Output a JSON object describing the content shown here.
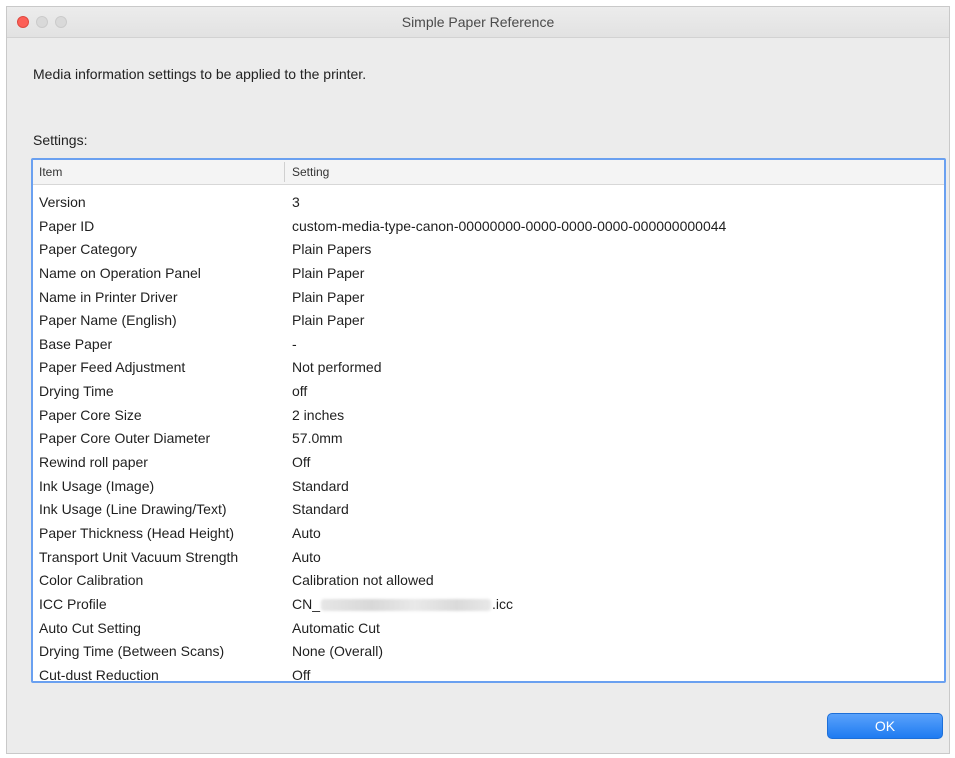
{
  "window": {
    "title": "Simple Paper Reference"
  },
  "description": "Media information settings to be applied to the printer.",
  "settings_label": "Settings:",
  "table": {
    "columns": [
      "Item",
      "Setting"
    ],
    "rows": [
      {
        "item": "Version",
        "setting": "3"
      },
      {
        "item": "Paper ID",
        "setting": "custom-media-type-canon-00000000-0000-0000-0000-000000000044"
      },
      {
        "item": "Paper Category",
        "setting": "Plain Papers"
      },
      {
        "item": "Name on Operation Panel",
        "setting": "Plain Paper"
      },
      {
        "item": "Name in Printer Driver",
        "setting": "Plain Paper"
      },
      {
        "item": "Paper Name (English)",
        "setting": "Plain Paper"
      },
      {
        "item": "Base Paper",
        "setting": "-"
      },
      {
        "item": "Paper Feed Adjustment",
        "setting": "Not performed"
      },
      {
        "item": "Drying Time",
        "setting": "off"
      },
      {
        "item": "Paper Core Size",
        "setting": "2 inches"
      },
      {
        "item": "Paper Core Outer Diameter",
        "setting": "57.0mm"
      },
      {
        "item": "Rewind roll paper",
        "setting": "Off"
      },
      {
        "item": "Ink Usage (Image)",
        "setting": "Standard"
      },
      {
        "item": "Ink Usage (Line Drawing/Text)",
        "setting": "Standard"
      },
      {
        "item": "Paper Thickness (Head Height)",
        "setting": "Auto"
      },
      {
        "item": "Transport Unit Vacuum Strength",
        "setting": "Auto"
      },
      {
        "item": "Color Calibration",
        "setting": "Calibration not allowed"
      },
      {
        "item": "ICC Profile",
        "setting_prefix": "CN_",
        "setting_suffix": ".icc"
      },
      {
        "item": "Auto Cut Setting",
        "setting": "Automatic Cut"
      },
      {
        "item": "Drying Time (Between Scans)",
        "setting": "None (Overall)"
      },
      {
        "item": "Cut-dust Reduction",
        "setting": "Off"
      }
    ]
  },
  "ok_button": {
    "label": "OK"
  },
  "colors": {
    "accent": "#1e7bf1",
    "focus_ring": "#6aa0f0",
    "close_button": "#fc5f57"
  }
}
